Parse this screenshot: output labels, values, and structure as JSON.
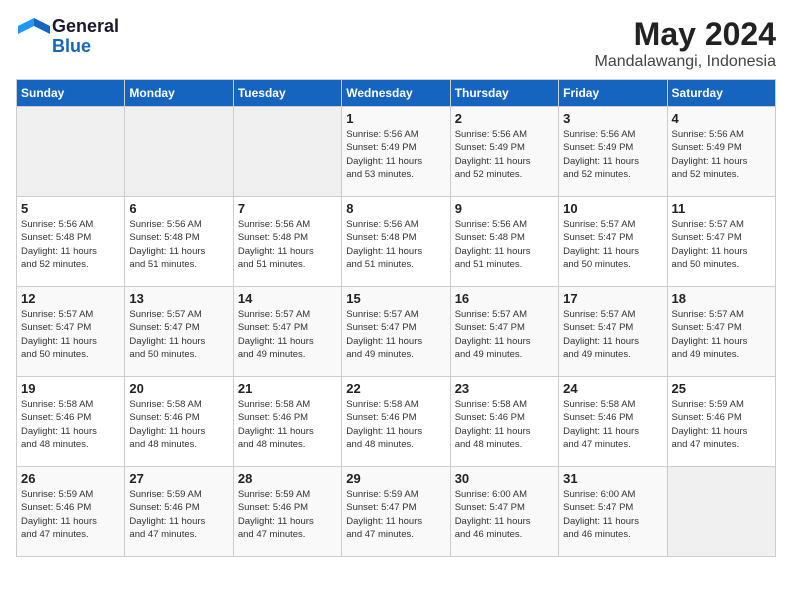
{
  "logo": {
    "line1": "General",
    "line2": "Blue"
  },
  "title": "May 2024",
  "subtitle": "Mandalawangi, Indonesia",
  "days_of_week": [
    "Sunday",
    "Monday",
    "Tuesday",
    "Wednesday",
    "Thursday",
    "Friday",
    "Saturday"
  ],
  "weeks": [
    [
      {
        "num": "",
        "info": ""
      },
      {
        "num": "",
        "info": ""
      },
      {
        "num": "",
        "info": ""
      },
      {
        "num": "1",
        "info": "Sunrise: 5:56 AM\nSunset: 5:49 PM\nDaylight: 11 hours\nand 53 minutes."
      },
      {
        "num": "2",
        "info": "Sunrise: 5:56 AM\nSunset: 5:49 PM\nDaylight: 11 hours\nand 52 minutes."
      },
      {
        "num": "3",
        "info": "Sunrise: 5:56 AM\nSunset: 5:49 PM\nDaylight: 11 hours\nand 52 minutes."
      },
      {
        "num": "4",
        "info": "Sunrise: 5:56 AM\nSunset: 5:49 PM\nDaylight: 11 hours\nand 52 minutes."
      }
    ],
    [
      {
        "num": "5",
        "info": "Sunrise: 5:56 AM\nSunset: 5:48 PM\nDaylight: 11 hours\nand 52 minutes."
      },
      {
        "num": "6",
        "info": "Sunrise: 5:56 AM\nSunset: 5:48 PM\nDaylight: 11 hours\nand 51 minutes."
      },
      {
        "num": "7",
        "info": "Sunrise: 5:56 AM\nSunset: 5:48 PM\nDaylight: 11 hours\nand 51 minutes."
      },
      {
        "num": "8",
        "info": "Sunrise: 5:56 AM\nSunset: 5:48 PM\nDaylight: 11 hours\nand 51 minutes."
      },
      {
        "num": "9",
        "info": "Sunrise: 5:56 AM\nSunset: 5:48 PM\nDaylight: 11 hours\nand 51 minutes."
      },
      {
        "num": "10",
        "info": "Sunrise: 5:57 AM\nSunset: 5:47 PM\nDaylight: 11 hours\nand 50 minutes."
      },
      {
        "num": "11",
        "info": "Sunrise: 5:57 AM\nSunset: 5:47 PM\nDaylight: 11 hours\nand 50 minutes."
      }
    ],
    [
      {
        "num": "12",
        "info": "Sunrise: 5:57 AM\nSunset: 5:47 PM\nDaylight: 11 hours\nand 50 minutes."
      },
      {
        "num": "13",
        "info": "Sunrise: 5:57 AM\nSunset: 5:47 PM\nDaylight: 11 hours\nand 50 minutes."
      },
      {
        "num": "14",
        "info": "Sunrise: 5:57 AM\nSunset: 5:47 PM\nDaylight: 11 hours\nand 49 minutes."
      },
      {
        "num": "15",
        "info": "Sunrise: 5:57 AM\nSunset: 5:47 PM\nDaylight: 11 hours\nand 49 minutes."
      },
      {
        "num": "16",
        "info": "Sunrise: 5:57 AM\nSunset: 5:47 PM\nDaylight: 11 hours\nand 49 minutes."
      },
      {
        "num": "17",
        "info": "Sunrise: 5:57 AM\nSunset: 5:47 PM\nDaylight: 11 hours\nand 49 minutes."
      },
      {
        "num": "18",
        "info": "Sunrise: 5:57 AM\nSunset: 5:47 PM\nDaylight: 11 hours\nand 49 minutes."
      }
    ],
    [
      {
        "num": "19",
        "info": "Sunrise: 5:58 AM\nSunset: 5:46 PM\nDaylight: 11 hours\nand 48 minutes."
      },
      {
        "num": "20",
        "info": "Sunrise: 5:58 AM\nSunset: 5:46 PM\nDaylight: 11 hours\nand 48 minutes."
      },
      {
        "num": "21",
        "info": "Sunrise: 5:58 AM\nSunset: 5:46 PM\nDaylight: 11 hours\nand 48 minutes."
      },
      {
        "num": "22",
        "info": "Sunrise: 5:58 AM\nSunset: 5:46 PM\nDaylight: 11 hours\nand 48 minutes."
      },
      {
        "num": "23",
        "info": "Sunrise: 5:58 AM\nSunset: 5:46 PM\nDaylight: 11 hours\nand 48 minutes."
      },
      {
        "num": "24",
        "info": "Sunrise: 5:58 AM\nSunset: 5:46 PM\nDaylight: 11 hours\nand 47 minutes."
      },
      {
        "num": "25",
        "info": "Sunrise: 5:59 AM\nSunset: 5:46 PM\nDaylight: 11 hours\nand 47 minutes."
      }
    ],
    [
      {
        "num": "26",
        "info": "Sunrise: 5:59 AM\nSunset: 5:46 PM\nDaylight: 11 hours\nand 47 minutes."
      },
      {
        "num": "27",
        "info": "Sunrise: 5:59 AM\nSunset: 5:46 PM\nDaylight: 11 hours\nand 47 minutes."
      },
      {
        "num": "28",
        "info": "Sunrise: 5:59 AM\nSunset: 5:46 PM\nDaylight: 11 hours\nand 47 minutes."
      },
      {
        "num": "29",
        "info": "Sunrise: 5:59 AM\nSunset: 5:47 PM\nDaylight: 11 hours\nand 47 minutes."
      },
      {
        "num": "30",
        "info": "Sunrise: 6:00 AM\nSunset: 5:47 PM\nDaylight: 11 hours\nand 46 minutes."
      },
      {
        "num": "31",
        "info": "Sunrise: 6:00 AM\nSunset: 5:47 PM\nDaylight: 11 hours\nand 46 minutes."
      },
      {
        "num": "",
        "info": ""
      }
    ]
  ]
}
